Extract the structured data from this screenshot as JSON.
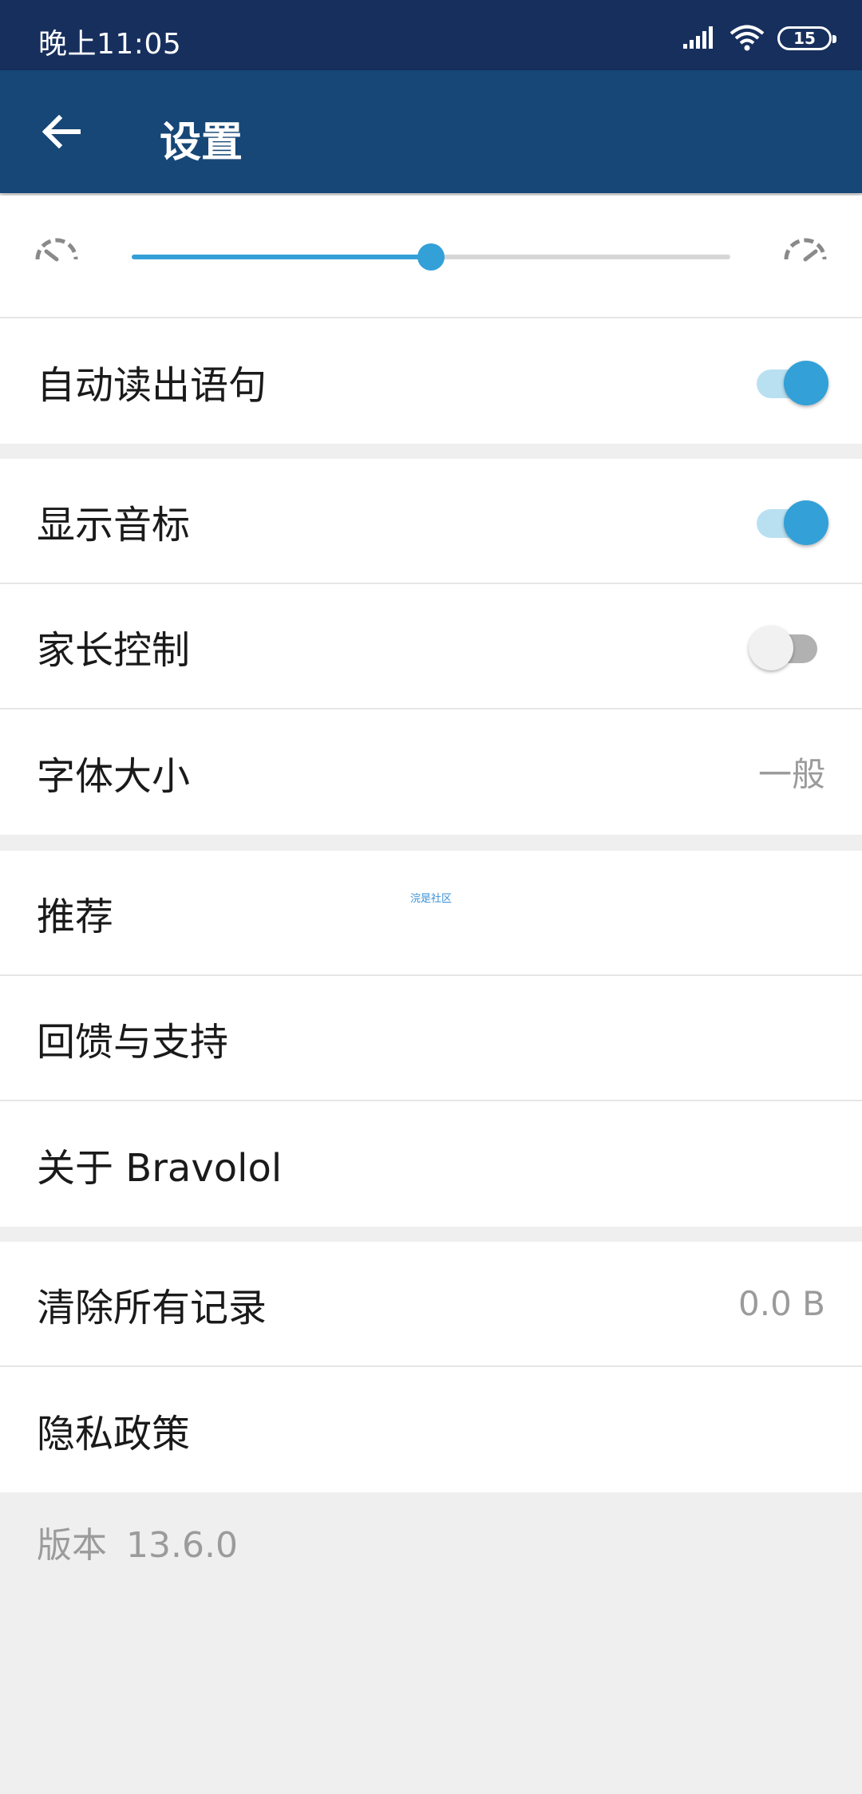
{
  "status_bar": {
    "time": "晚上11:05",
    "battery": "15"
  },
  "app_bar": {
    "title": "设置"
  },
  "speed": {
    "level": 0.5
  },
  "settings": {
    "auto_read": {
      "label": "自动读出语句",
      "on": true
    },
    "show_phonetic": {
      "label": "显示音标",
      "on": true
    },
    "parental_control": {
      "label": "家长控制",
      "on": false
    },
    "font_size": {
      "label": "字体大小",
      "value": "一般"
    },
    "recommend": {
      "label": "推荐"
    },
    "feedback": {
      "label": "回馈与支持"
    },
    "about": {
      "label": "关于 Bravolol"
    },
    "clear_records": {
      "label": "清除所有记录",
      "value": "0.0 B"
    },
    "privacy": {
      "label": "隐私政策"
    }
  },
  "watermark": "浣是社区",
  "version": {
    "label": "版本",
    "number": "13.6.0"
  },
  "colors": {
    "status_bar": "#172f5d",
    "app_bar": "#164776",
    "accent": "#33a0d8"
  }
}
